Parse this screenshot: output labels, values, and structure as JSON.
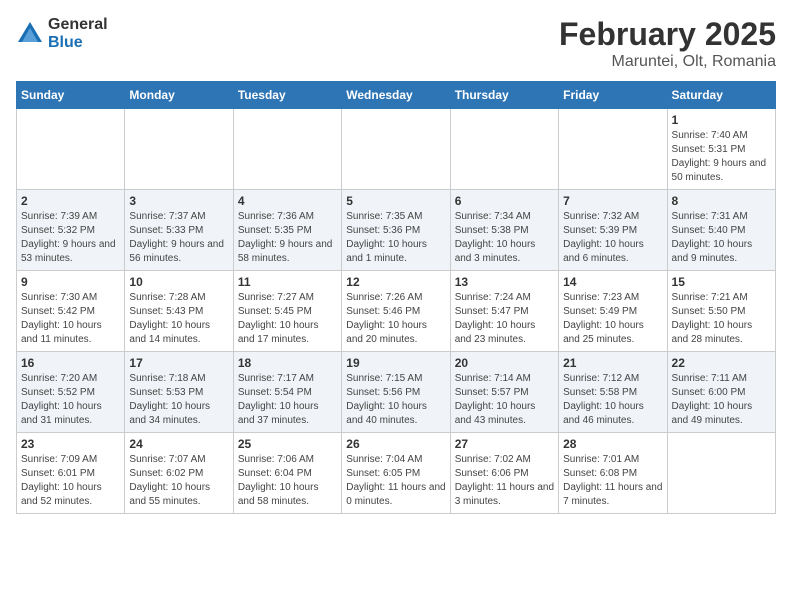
{
  "logo": {
    "general": "General",
    "blue": "Blue"
  },
  "title": {
    "month": "February 2025",
    "location": "Maruntei, Olt, Romania"
  },
  "weekdays": [
    "Sunday",
    "Monday",
    "Tuesday",
    "Wednesday",
    "Thursday",
    "Friday",
    "Saturday"
  ],
  "weeks": [
    [
      {
        "day": "",
        "info": ""
      },
      {
        "day": "",
        "info": ""
      },
      {
        "day": "",
        "info": ""
      },
      {
        "day": "",
        "info": ""
      },
      {
        "day": "",
        "info": ""
      },
      {
        "day": "",
        "info": ""
      },
      {
        "day": "1",
        "info": "Sunrise: 7:40 AM\nSunset: 5:31 PM\nDaylight: 9 hours and 50 minutes."
      }
    ],
    [
      {
        "day": "2",
        "info": "Sunrise: 7:39 AM\nSunset: 5:32 PM\nDaylight: 9 hours and 53 minutes."
      },
      {
        "day": "3",
        "info": "Sunrise: 7:37 AM\nSunset: 5:33 PM\nDaylight: 9 hours and 56 minutes."
      },
      {
        "day": "4",
        "info": "Sunrise: 7:36 AM\nSunset: 5:35 PM\nDaylight: 9 hours and 58 minutes."
      },
      {
        "day": "5",
        "info": "Sunrise: 7:35 AM\nSunset: 5:36 PM\nDaylight: 10 hours and 1 minute."
      },
      {
        "day": "6",
        "info": "Sunrise: 7:34 AM\nSunset: 5:38 PM\nDaylight: 10 hours and 3 minutes."
      },
      {
        "day": "7",
        "info": "Sunrise: 7:32 AM\nSunset: 5:39 PM\nDaylight: 10 hours and 6 minutes."
      },
      {
        "day": "8",
        "info": "Sunrise: 7:31 AM\nSunset: 5:40 PM\nDaylight: 10 hours and 9 minutes."
      }
    ],
    [
      {
        "day": "9",
        "info": "Sunrise: 7:30 AM\nSunset: 5:42 PM\nDaylight: 10 hours and 11 minutes."
      },
      {
        "day": "10",
        "info": "Sunrise: 7:28 AM\nSunset: 5:43 PM\nDaylight: 10 hours and 14 minutes."
      },
      {
        "day": "11",
        "info": "Sunrise: 7:27 AM\nSunset: 5:45 PM\nDaylight: 10 hours and 17 minutes."
      },
      {
        "day": "12",
        "info": "Sunrise: 7:26 AM\nSunset: 5:46 PM\nDaylight: 10 hours and 20 minutes."
      },
      {
        "day": "13",
        "info": "Sunrise: 7:24 AM\nSunset: 5:47 PM\nDaylight: 10 hours and 23 minutes."
      },
      {
        "day": "14",
        "info": "Sunrise: 7:23 AM\nSunset: 5:49 PM\nDaylight: 10 hours and 25 minutes."
      },
      {
        "day": "15",
        "info": "Sunrise: 7:21 AM\nSunset: 5:50 PM\nDaylight: 10 hours and 28 minutes."
      }
    ],
    [
      {
        "day": "16",
        "info": "Sunrise: 7:20 AM\nSunset: 5:52 PM\nDaylight: 10 hours and 31 minutes."
      },
      {
        "day": "17",
        "info": "Sunrise: 7:18 AM\nSunset: 5:53 PM\nDaylight: 10 hours and 34 minutes."
      },
      {
        "day": "18",
        "info": "Sunrise: 7:17 AM\nSunset: 5:54 PM\nDaylight: 10 hours and 37 minutes."
      },
      {
        "day": "19",
        "info": "Sunrise: 7:15 AM\nSunset: 5:56 PM\nDaylight: 10 hours and 40 minutes."
      },
      {
        "day": "20",
        "info": "Sunrise: 7:14 AM\nSunset: 5:57 PM\nDaylight: 10 hours and 43 minutes."
      },
      {
        "day": "21",
        "info": "Sunrise: 7:12 AM\nSunset: 5:58 PM\nDaylight: 10 hours and 46 minutes."
      },
      {
        "day": "22",
        "info": "Sunrise: 7:11 AM\nSunset: 6:00 PM\nDaylight: 10 hours and 49 minutes."
      }
    ],
    [
      {
        "day": "23",
        "info": "Sunrise: 7:09 AM\nSunset: 6:01 PM\nDaylight: 10 hours and 52 minutes."
      },
      {
        "day": "24",
        "info": "Sunrise: 7:07 AM\nSunset: 6:02 PM\nDaylight: 10 hours and 55 minutes."
      },
      {
        "day": "25",
        "info": "Sunrise: 7:06 AM\nSunset: 6:04 PM\nDaylight: 10 hours and 58 minutes."
      },
      {
        "day": "26",
        "info": "Sunrise: 7:04 AM\nSunset: 6:05 PM\nDaylight: 11 hours and 0 minutes."
      },
      {
        "day": "27",
        "info": "Sunrise: 7:02 AM\nSunset: 6:06 PM\nDaylight: 11 hours and 3 minutes."
      },
      {
        "day": "28",
        "info": "Sunrise: 7:01 AM\nSunset: 6:08 PM\nDaylight: 11 hours and 7 minutes."
      },
      {
        "day": "",
        "info": ""
      }
    ]
  ]
}
